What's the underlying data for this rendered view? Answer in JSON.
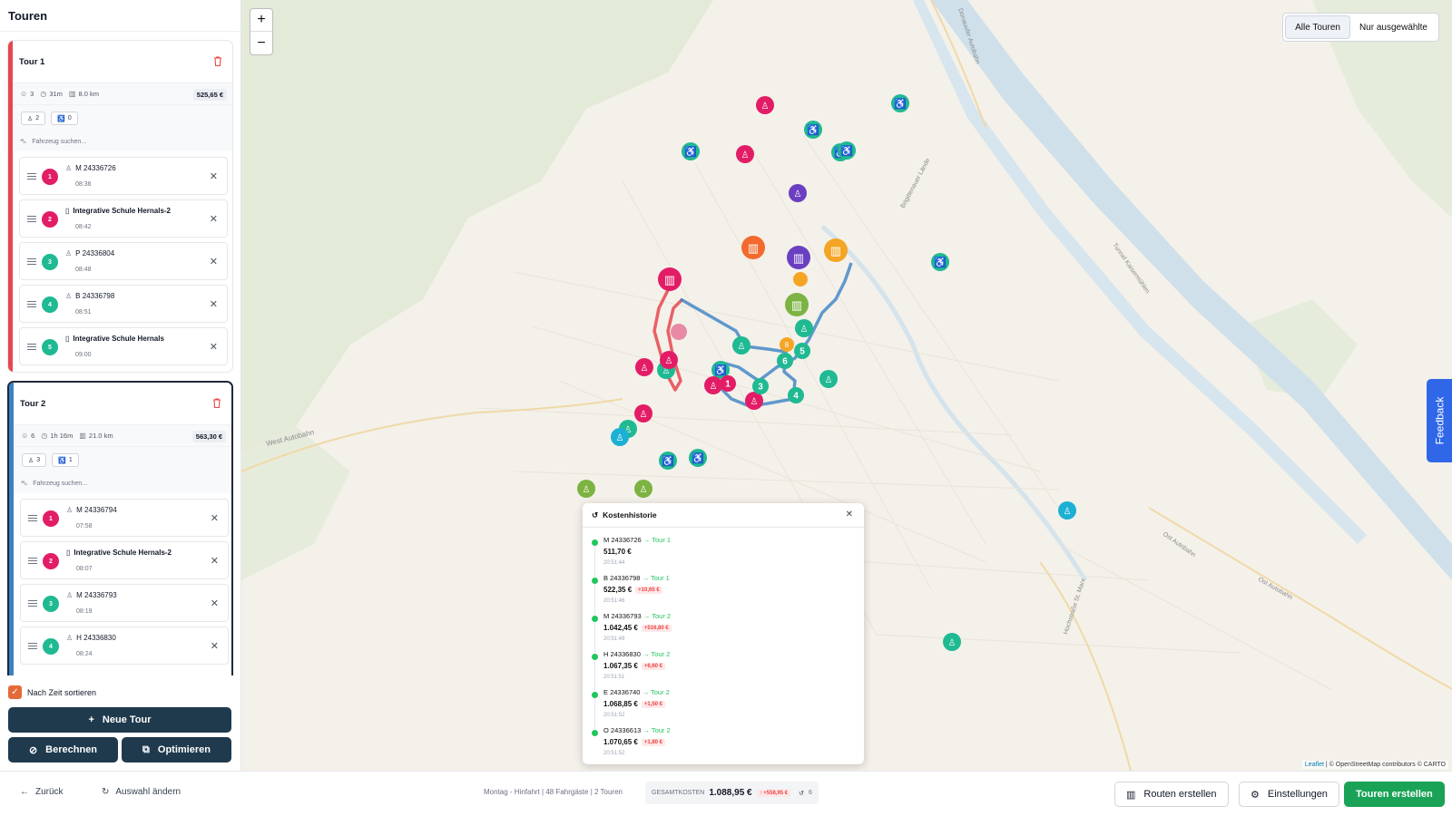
{
  "sidebar": {
    "title": "Touren",
    "vehicle_placeholder": "Fahrzeug suchen...",
    "tours": [
      {
        "name": "Tour 1",
        "color": "#e5484d",
        "stats": {
          "passengers": "3",
          "duration": "31m",
          "distance": "8.0 km",
          "cost": "525,65 €"
        },
        "caps": {
          "seats": "2",
          "wheelchair": "0"
        },
        "stops": [
          {
            "n": "1",
            "name": "M 24336726",
            "time": "08:36",
            "kind": "person",
            "color": "#e31c66"
          },
          {
            "n": "2",
            "name": "Integrative Schule Hernals-2",
            "time": "08:42",
            "kind": "school",
            "color": "#e31c66"
          },
          {
            "n": "3",
            "name": "P 24336804",
            "time": "08:48",
            "kind": "person",
            "color": "#1fb992"
          },
          {
            "n": "4",
            "name": "B 24336798",
            "time": "08:51",
            "kind": "person",
            "color": "#1fb992"
          },
          {
            "n": "5",
            "name": "Integrative Schule Hernals",
            "time": "09:00",
            "kind": "school",
            "color": "#1fb992"
          }
        ]
      },
      {
        "name": "Tour 2",
        "color": "#3b82c4",
        "stats": {
          "passengers": "6",
          "duration": "1h 16m",
          "distance": "21.0 km",
          "cost": "563,30 €"
        },
        "caps": {
          "seats": "3",
          "wheelchair": "1"
        },
        "stops": [
          {
            "n": "1",
            "name": "M 24336794",
            "time": "07:58",
            "kind": "person",
            "color": "#e31c66"
          },
          {
            "n": "2",
            "name": "Integrative Schule Hernals-2",
            "time": "08:07",
            "kind": "school",
            "color": "#e31c66"
          },
          {
            "n": "3",
            "name": "M 24336793",
            "time": "08:19",
            "kind": "person",
            "color": "#1fb992"
          },
          {
            "n": "4",
            "name": "H 24336830",
            "time": "08:24",
            "kind": "person",
            "color": "#1fb992"
          }
        ]
      }
    ],
    "sort_label": "Nach Zeit sortieren",
    "new_tour": "Neue Tour",
    "calculate": "Berechnen",
    "optimize": "Optimieren"
  },
  "map": {
    "zoom_in": "+",
    "zoom_out": "−",
    "toggle_all": "Alle Touren",
    "toggle_selected": "Nur ausgewählte",
    "feedback": "Feedback",
    "attribution_leaflet": "Leaflet",
    "attribution_rest": "| © OpenStreetMap contributors © CARTO",
    "labels": {
      "autobahn_west": "West Autobahn",
      "guertel": "Brigittenauer Lände",
      "tunnel": "Tunnel Kaisermühlen",
      "ost_autobahn": "Ost Autobahn",
      "hochstrasse": "Hochstraße St. Marx",
      "ost_autobahn2": "Ost Autobahn",
      "donau": "Donauufer Autobahn"
    }
  },
  "popup": {
    "title": "Kostenhistorie",
    "entries": [
      {
        "name": "M 24336726",
        "tour": "→ Tour 1",
        "cost": "511,70 €",
        "delta": "",
        "time": "20:51:44"
      },
      {
        "name": "B 24336798",
        "tour": "→ Tour 1",
        "cost": "522,35 €",
        "delta": "+10,65 €",
        "time": "20:51:46"
      },
      {
        "name": "M 24336793",
        "tour": "→ Tour 2",
        "cost": "1.042,45 €",
        "delta": "+516,80 €",
        "time": "20:51:49"
      },
      {
        "name": "H 24336830",
        "tour": "→ Tour 2",
        "cost": "1.067,35 €",
        "delta": "+6,60 €",
        "time": "20:51:51"
      },
      {
        "name": "E 24336740",
        "tour": "→ Tour 2",
        "cost": "1.068,85 €",
        "delta": "+1,50 €",
        "time": "20:51:52"
      },
      {
        "name": "O 24336613",
        "tour": "→ Tour 2",
        "cost": "1.070,65 €",
        "delta": "+1,80 €",
        "time": "20:51:52"
      }
    ]
  },
  "footer": {
    "back": "Zurück",
    "change": "Auswahl ändern",
    "info": "Montag - Hinfahrt | 48 Fahrgäste | 2 Touren",
    "total_label": "GESAMTKOSTEN",
    "total": "1.088,95 €",
    "total_delta": "↑ +558,95 €",
    "history_count": "6",
    "routes": "Routen erstellen",
    "settings": "Einstellungen",
    "create": "Touren erstellen"
  }
}
